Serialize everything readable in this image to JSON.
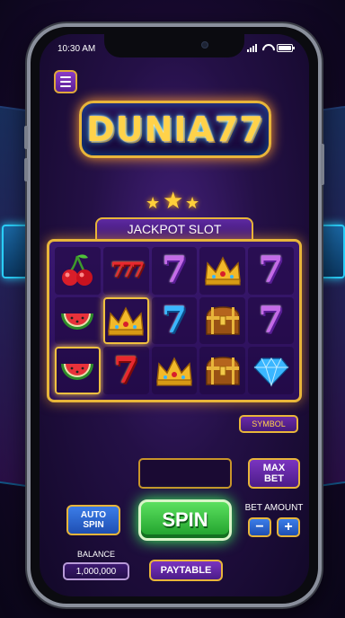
{
  "status_bar": {
    "time": "10:30 AM"
  },
  "header": {
    "logo_text": "DUNIA77"
  },
  "slot": {
    "banner": "JACKPOT SLOT",
    "reels": [
      [
        "cherry",
        "triple-seven-red",
        "seven-purple",
        "crown",
        "seven-purple"
      ],
      [
        "watermelon",
        "crown",
        "seven-blue",
        "treasure-chest",
        "seven-purple"
      ],
      [
        "watermelon",
        "seven-red",
        "crown",
        "treasure-chest",
        "diamond"
      ]
    ],
    "highlighted_cells": [
      "1-1",
      "2-0"
    ]
  },
  "controls": {
    "symbol_label": "SYMBOL",
    "maxbet_line1": "MAX",
    "maxbet_line2": "BET",
    "autospin_line1": "AUTO",
    "autospin_line2": "SPIN",
    "spin_label": "SPIN",
    "bet_amount_label": "BET AMOUNT",
    "minus_label": "−",
    "plus_label": "+",
    "balance_label": "BALANCE",
    "balance_value": "1,000,000",
    "paytable_label": "PAYTABLE"
  },
  "colors": {
    "accent_gold": "#e8b53a",
    "spin_green": "#1e9e2a",
    "button_blue": "#1f4fb3",
    "button_purple": "#4c1c88"
  }
}
